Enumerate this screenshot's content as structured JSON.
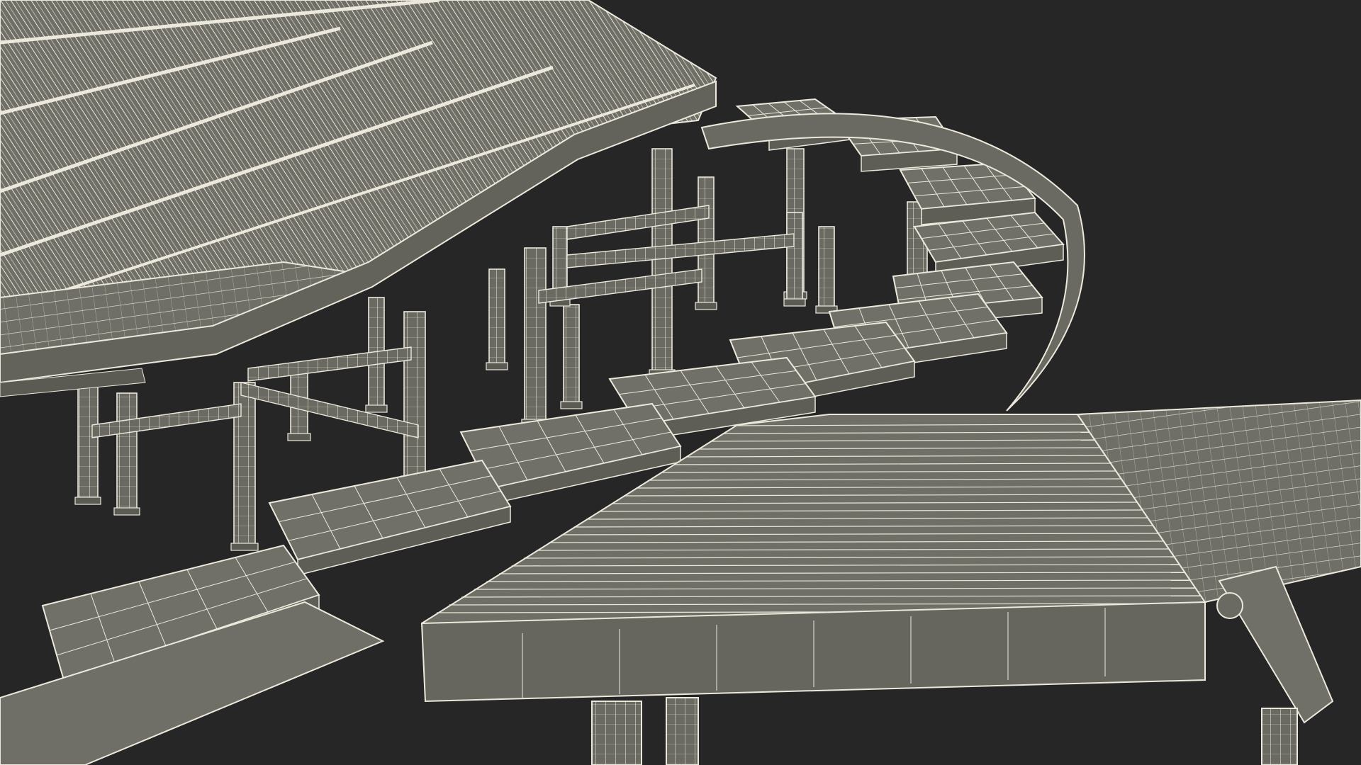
{
  "image": {
    "subject": "wireframe-conveyor-render",
    "background_color": "#262626",
    "surface_color": "#6f6f67",
    "surface_dark": "#5b5b54",
    "wire_color": "#ece9dc"
  }
}
